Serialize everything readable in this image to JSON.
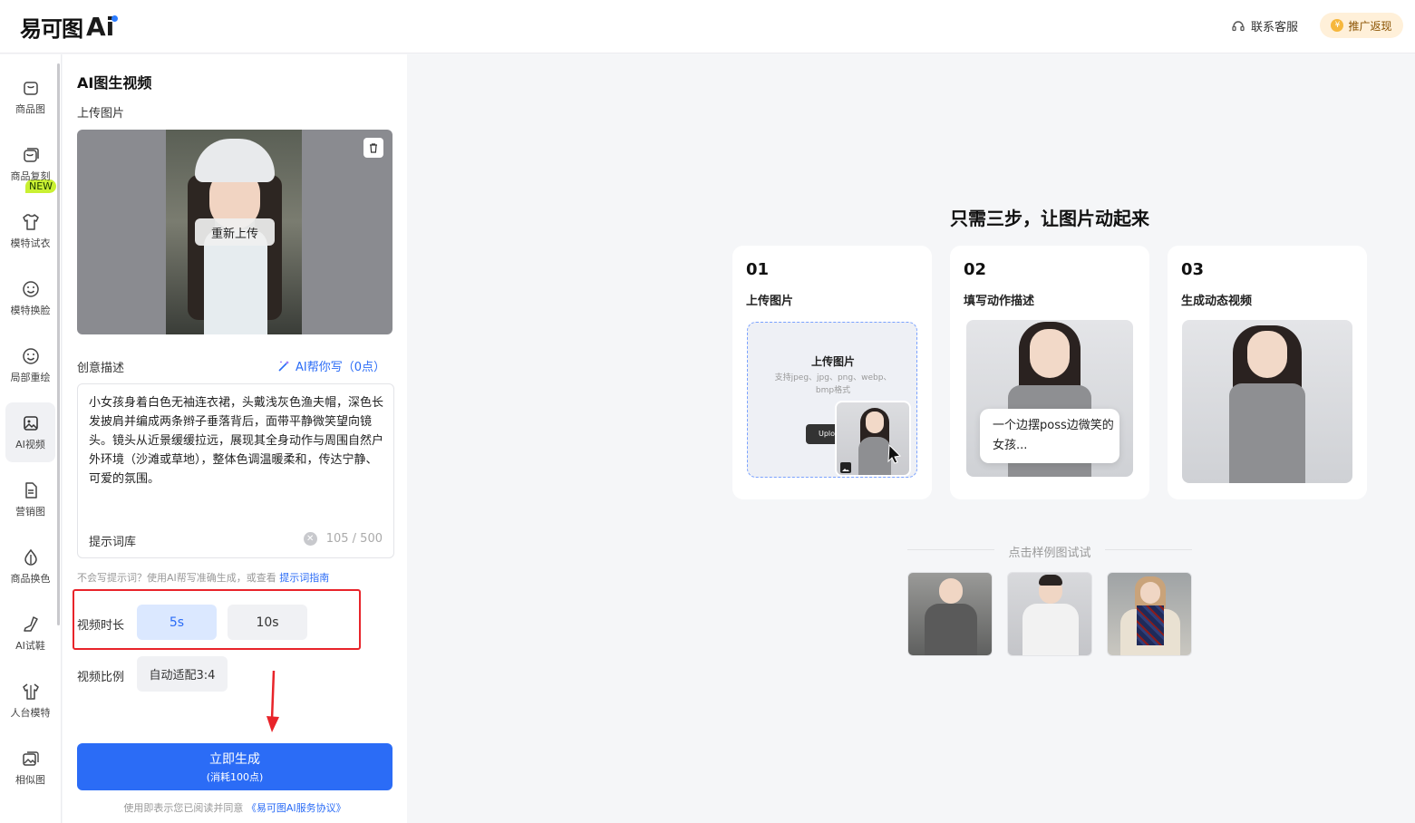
{
  "header": {
    "logo_text": "易可图",
    "logo_ai": "Ai",
    "contact_label": "联系客服",
    "promote_label": "推广返现"
  },
  "nav": {
    "new_badge": "NEW",
    "items": [
      {
        "label": "商品图",
        "icon": "bag-icon"
      },
      {
        "label": "商品复刻",
        "icon": "copy-bag-icon"
      },
      {
        "label": "模特试衣",
        "icon": "shirt-icon"
      },
      {
        "label": "模特换脸",
        "icon": "face-icon"
      },
      {
        "label": "局部重绘",
        "icon": "face-edit-icon"
      },
      {
        "label": "AI视频",
        "icon": "video-icon"
      },
      {
        "label": "营销图",
        "icon": "document-icon"
      },
      {
        "label": "商品换色",
        "icon": "drop-icon"
      },
      {
        "label": "AI试鞋",
        "icon": "shoe-icon"
      },
      {
        "label": "人台模特",
        "icon": "mannequin-icon"
      },
      {
        "label": "相似图",
        "icon": "images-icon"
      }
    ]
  },
  "panel": {
    "title": "AI图生视频",
    "upload_label": "上传图片",
    "reupload_label": "重新上传",
    "desc_label": "创意描述",
    "ai_help_label": "AI帮你写（0点）",
    "desc_text": "小女孩身着白色无袖连衣裙，头戴浅灰色渔夫帽，深色长发披肩并编成两条辫子垂落背后，面带平静微笑望向镜头。镜头从近景缓缓拉远，展现其全身动作与周围自然户外环境（沙滩或草地），整体色调温暖柔和，传达宁静、可爱的氛围。",
    "prompt_lib_label": "提示词库",
    "char_count": "105 / 500",
    "hint_text": "不会写提示词？使用AI帮写准确生成，或查看 ",
    "hint_link": "提示词指南",
    "duration_label": "视频时长",
    "duration_options": [
      "5s",
      "10s"
    ],
    "duration_selected": "5s",
    "ratio_label": "视频比例",
    "ratio_value": "自动适配3:4",
    "generate_label": "立即生成",
    "generate_cost": "(消耗100点)",
    "agree_text": "使用即表示您已阅读并同意 ",
    "agree_link": "《易可图AI服务协议》"
  },
  "main": {
    "title": "只需三步，让图片动起来",
    "steps": [
      {
        "num": "01",
        "name": "上传图片"
      },
      {
        "num": "02",
        "name": "填写动作描述"
      },
      {
        "num": "03",
        "name": "生成动态视频"
      }
    ],
    "mini_upload_title": "上传图片",
    "mini_upload_sub": "支持jpeg、jpg、png、webp、bmp格式",
    "mini_upload_btn": "Uplo",
    "bubble_text": "一个边摆poss边微笑的女孩...",
    "sample_label": "点击样例图试试"
  },
  "colors": {
    "accent": "#2b6cf6",
    "selected_bg": "#dbe8ff",
    "highlight_frame": "#e8242a",
    "new_badge": "#c9f032"
  }
}
